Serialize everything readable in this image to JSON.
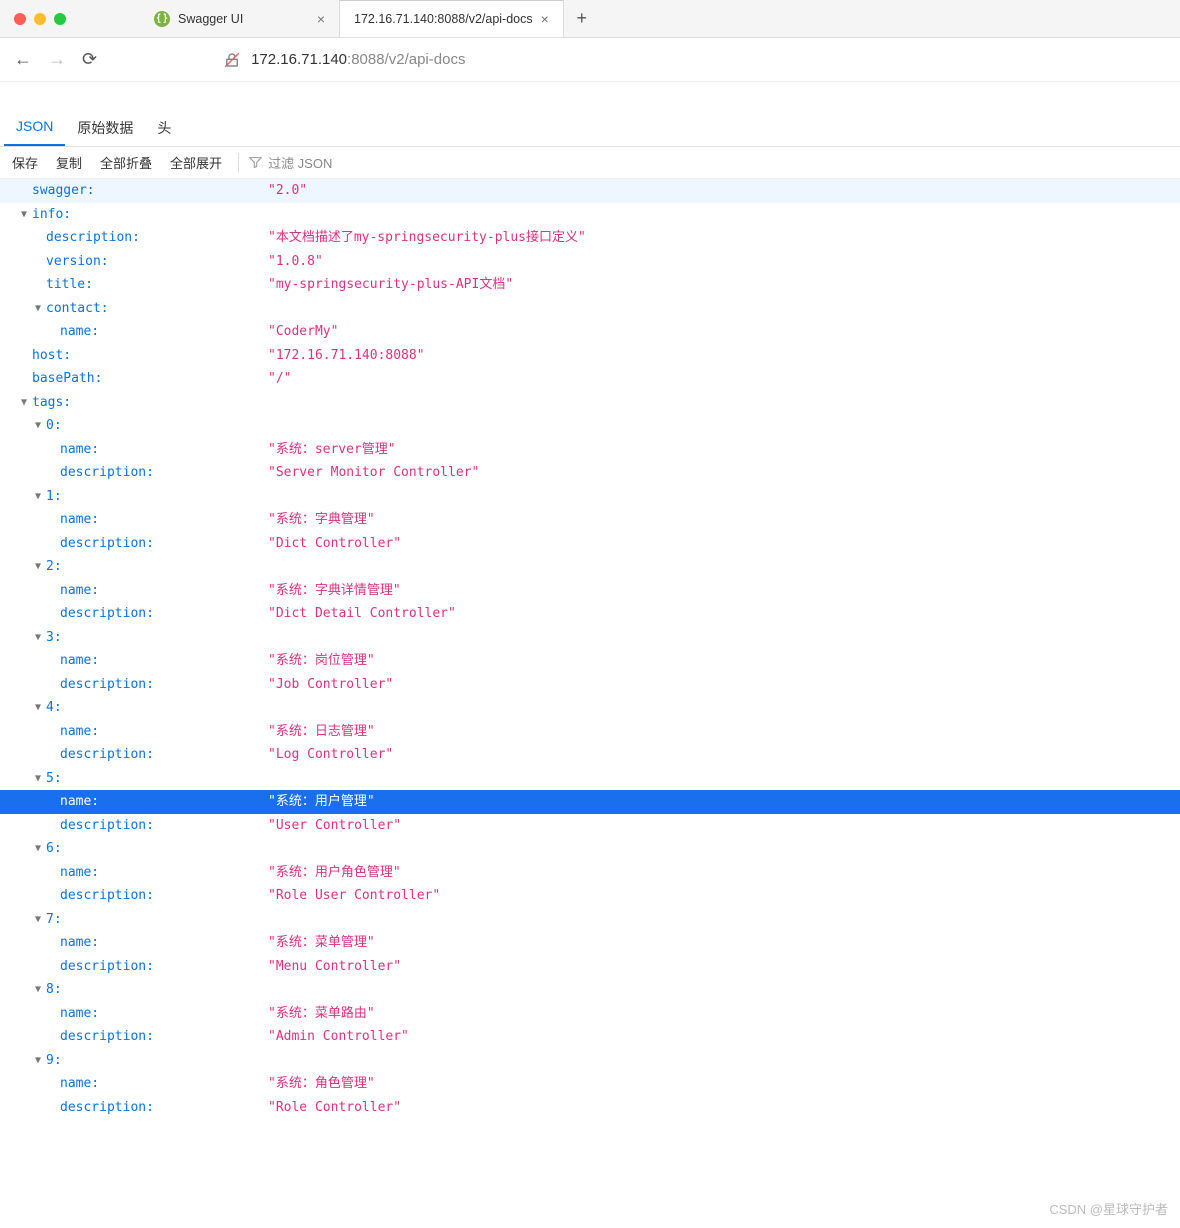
{
  "browser": {
    "tabs": [
      {
        "title": "Swagger UI",
        "favicon_letter": ""
      },
      {
        "title": "172.16.71.140:8088/v2/api-docs",
        "active": true
      }
    ],
    "url_host": "172.16.71.140",
    "url_path": ":8088/v2/api-docs"
  },
  "viewtabs": {
    "json": "JSON",
    "raw": "原始数据",
    "headers": "头"
  },
  "actions": {
    "save": "保存",
    "copy": "复制",
    "collapse": "全部折叠",
    "expand": "全部展开",
    "filter_placeholder": "过滤 JSON"
  },
  "json": {
    "swagger": {
      "k": "swagger:",
      "v": "\"2.0\""
    },
    "info": {
      "k": "info:"
    },
    "info_description": {
      "k": "description:",
      "v": "\"本文档描述了my-springsecurity-plus接口定义\""
    },
    "info_version": {
      "k": "version:",
      "v": "\"1.0.8\""
    },
    "info_title": {
      "k": "title:",
      "v": "\"my-springsecurity-plus-API文档\""
    },
    "info_contact": {
      "k": "contact:"
    },
    "info_contact_name": {
      "k": "name:",
      "v": "\"CoderMy\""
    },
    "host": {
      "k": "host:",
      "v": "\"172.16.71.140:8088\""
    },
    "basePath": {
      "k": "basePath:",
      "v": "\"/\""
    },
    "tags": {
      "k": "tags:"
    },
    "t0": {
      "k": "0:"
    },
    "t0n": {
      "k": "name:",
      "v": "\"系统：server管理\""
    },
    "t0d": {
      "k": "description:",
      "v": "\"Server Monitor Controller\""
    },
    "t1": {
      "k": "1:"
    },
    "t1n": {
      "k": "name:",
      "v": "\"系统：字典管理\""
    },
    "t1d": {
      "k": "description:",
      "v": "\"Dict Controller\""
    },
    "t2": {
      "k": "2:"
    },
    "t2n": {
      "k": "name:",
      "v": "\"系统：字典详情管理\""
    },
    "t2d": {
      "k": "description:",
      "v": "\"Dict Detail Controller\""
    },
    "t3": {
      "k": "3:"
    },
    "t3n": {
      "k": "name:",
      "v": "\"系统：岗位管理\""
    },
    "t3d": {
      "k": "description:",
      "v": "\"Job Controller\""
    },
    "t4": {
      "k": "4:"
    },
    "t4n": {
      "k": "name:",
      "v": "\"系统：日志管理\""
    },
    "t4d": {
      "k": "description:",
      "v": "\"Log Controller\""
    },
    "t5": {
      "k": "5:"
    },
    "t5n": {
      "k": "name:",
      "v": "\"系统：用户管理\""
    },
    "t5d": {
      "k": "description:",
      "v": "\"User Controller\""
    },
    "t6": {
      "k": "6:"
    },
    "t6n": {
      "k": "name:",
      "v": "\"系统：用户角色管理\""
    },
    "t6d": {
      "k": "description:",
      "v": "\"Role User Controller\""
    },
    "t7": {
      "k": "7:"
    },
    "t7n": {
      "k": "name:",
      "v": "\"系统：菜单管理\""
    },
    "t7d": {
      "k": "description:",
      "v": "\"Menu Controller\""
    },
    "t8": {
      "k": "8:"
    },
    "t8n": {
      "k": "name:",
      "v": "\"系统：菜单路由\""
    },
    "t8d": {
      "k": "description:",
      "v": "\"Admin Controller\""
    },
    "t9": {
      "k": "9:"
    },
    "t9n": {
      "k": "name:",
      "v": "\"系统：角色管理\""
    },
    "t9d": {
      "k": "description:",
      "v": "\"Role Controller\""
    }
  },
  "watermark": "CSDN @星球守护者"
}
